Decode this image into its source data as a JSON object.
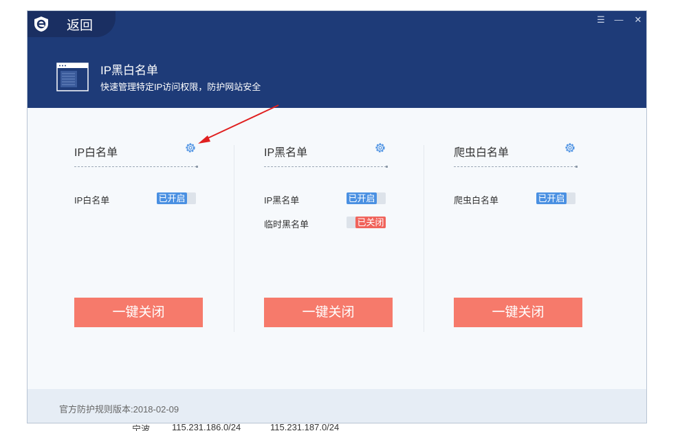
{
  "header": {
    "back_label": "返回",
    "title": "IP黑白名单",
    "subtitle": "快速管理特定IP访问权限，防护网站安全"
  },
  "window_controls": [
    "menu-icon",
    "minimize-icon",
    "close-icon"
  ],
  "panels": [
    {
      "title": "IP白名单",
      "rows": [
        {
          "label": "IP白名单",
          "state": "已开启",
          "on": true
        }
      ],
      "button": "一键关闭"
    },
    {
      "title": "IP黑名单",
      "rows": [
        {
          "label": "IP黑名单",
          "state": "已开启",
          "on": true
        },
        {
          "label": "临时黑名单",
          "state": "已关闭",
          "on": false
        }
      ],
      "button": "一键关闭"
    },
    {
      "title": "爬虫白名单",
      "rows": [
        {
          "label": "爬虫白名单",
          "state": "已开启",
          "on": true
        }
      ],
      "button": "一键关闭"
    }
  ],
  "footer": {
    "version_text": "官方防护规则版本:2018-02-09"
  },
  "below_window": {
    "city": "宁波",
    "ip1": "115.231.186.0/24",
    "ip2": "115.231.187.0/24"
  },
  "colors": {
    "header_bg": "#1e3b78",
    "accent_on": "#4a90e2",
    "accent_off": "#f0635b",
    "button_bg": "#f67a6b"
  }
}
